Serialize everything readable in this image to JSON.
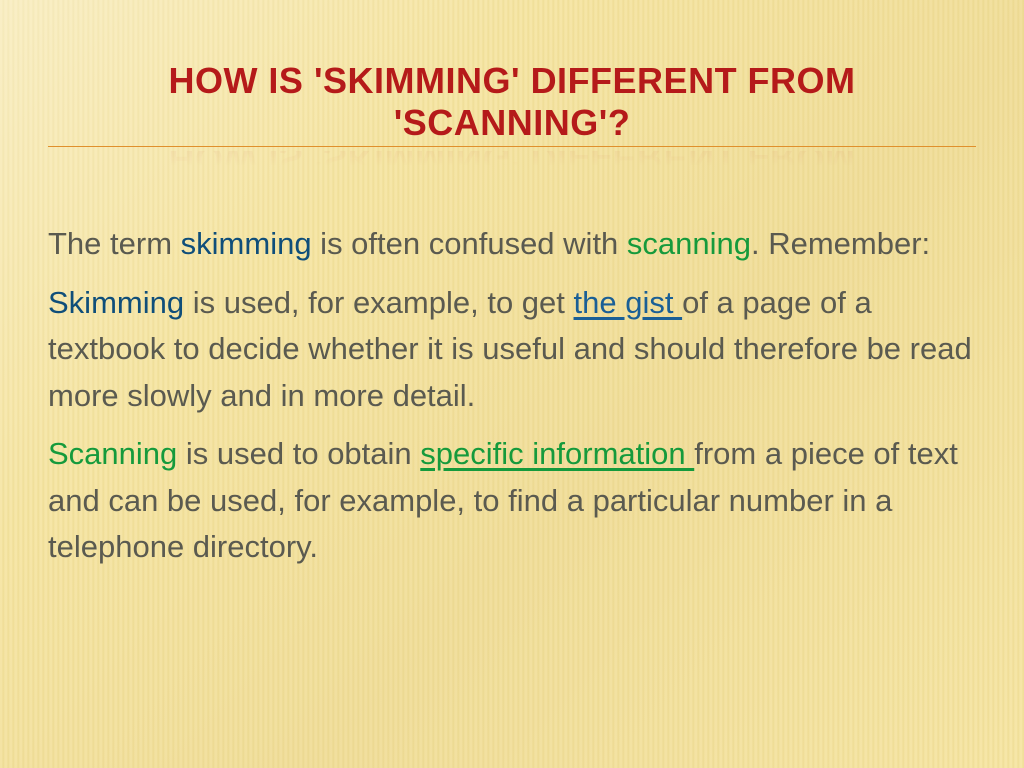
{
  "title": "HOW IS 'SKIMMING' DIFFERENT FROM 'SCANNING'?",
  "p1": {
    "t1": "The term ",
    "skimming": "skimming",
    "t2": " is often confused with ",
    "scanning": "scanning",
    "t3": ". Remember:"
  },
  "p2": {
    "skimming": "Skimming",
    "t1": " is used, for example, to get ",
    "gist": "the gist ",
    "t2": "of a page of a textbook to decide whether it is useful and should therefore be read more slowly and in more detail."
  },
  "p3": {
    "scanning": "Scanning",
    "t1": " is used to obtain ",
    "specific": "specific information ",
    "t2": "from a piece of text and can be used, for example, to find a particular number in a telephone directory."
  }
}
